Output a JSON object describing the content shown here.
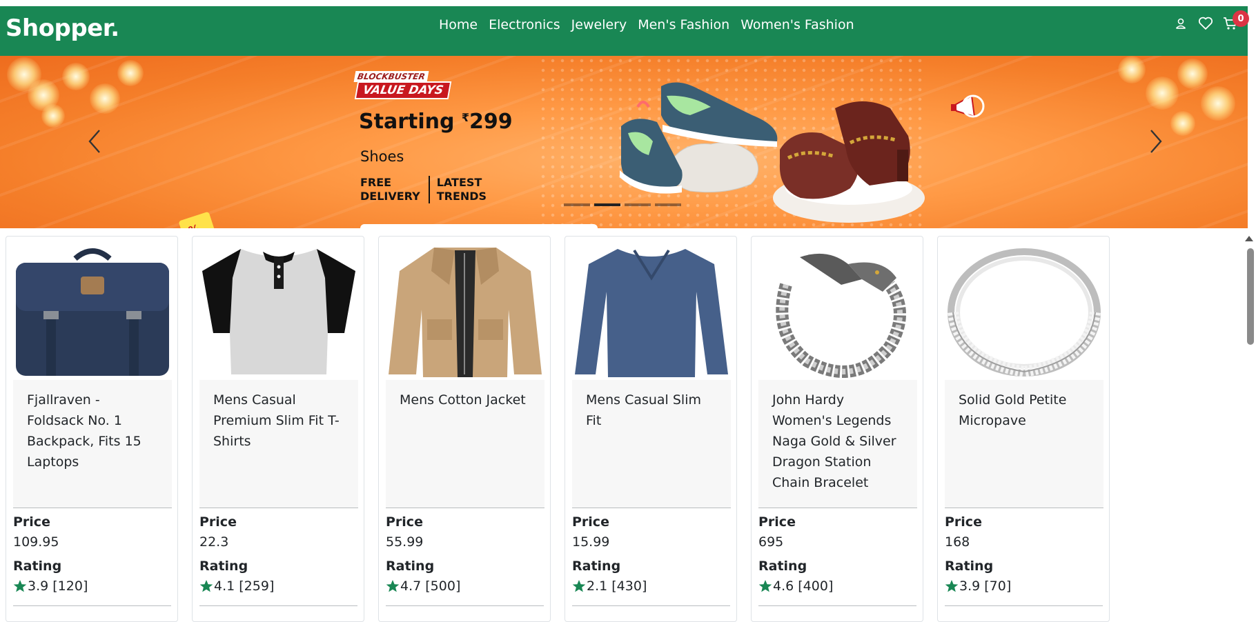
{
  "navbar": {
    "brand": "Shopper.",
    "links": [
      "Home",
      "Electronics",
      "Jewelery",
      "Men's Fashion",
      "Women's Fashion"
    ],
    "icons": [
      "user-icon",
      "heart-icon",
      "cart-icon"
    ],
    "cart_count": "0",
    "color": "#198754"
  },
  "hero": {
    "badge_top": "BLOCKBUSTER",
    "badge_bottom": "VALUE DAYS",
    "price_prefix": "Starting ",
    "currency": "₹",
    "price": "299",
    "category": "Shoes",
    "feature_1_line_1": "FREE",
    "feature_1_line_2": "DELIVERY",
    "feature_2_line_1": "LATEST",
    "feature_2_line_2": "TRENDS",
    "indicator_count": 4,
    "active_indicator": 1
  },
  "product_labels": {
    "price": "Price",
    "rating": "Rating"
  },
  "products": [
    {
      "title": "Fjallraven - Foldsack No. 1 Backpack, Fits 15 Laptops",
      "price": "109.95",
      "rating": "3.9",
      "count": "[120]",
      "image": "backpack"
    },
    {
      "title": "Mens Casual Premium Slim Fit T-Shirts",
      "price": "22.3",
      "rating": "4.1",
      "count": "[259]",
      "image": "tshirt"
    },
    {
      "title": "Mens Cotton Jacket",
      "price": "55.99",
      "rating": "4.7",
      "count": "[500]",
      "image": "jacket"
    },
    {
      "title": "Mens Casual Slim Fit",
      "price": "15.99",
      "rating": "2.1",
      "count": "[430]",
      "image": "longsleeve"
    },
    {
      "title": "John Hardy Women's Legends Naga Gold & Silver Dragon Station Chain Bracelet",
      "price": "695",
      "rating": "4.6",
      "count": "[400]",
      "image": "bracelet"
    },
    {
      "title": "Solid Gold Petite Micropave",
      "price": "168",
      "rating": "3.9",
      "count": "[70]",
      "image": "ring"
    }
  ],
  "star_color": "#198754"
}
